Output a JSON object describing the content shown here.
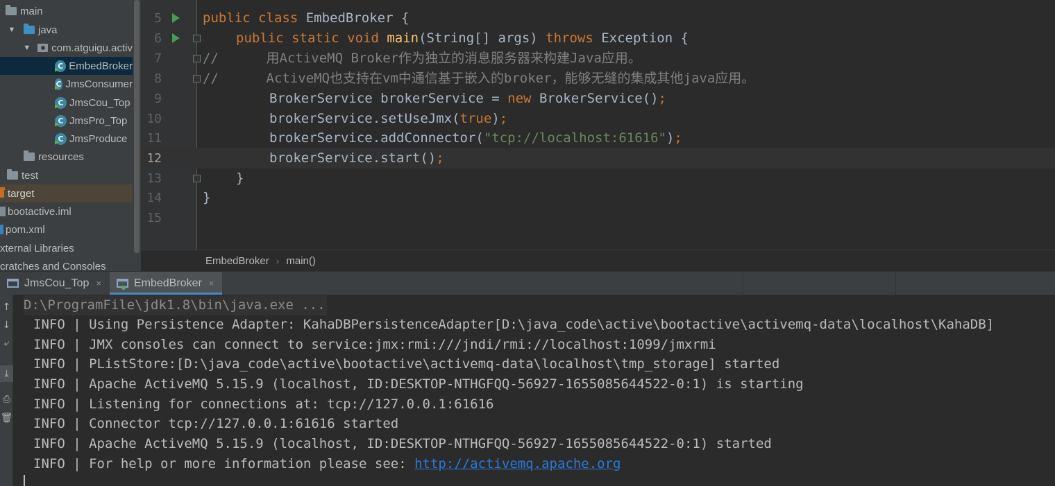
{
  "project_tree": {
    "items": [
      {
        "label": "main",
        "type": "folder"
      },
      {
        "label": "java",
        "type": "source-folder"
      },
      {
        "label": "com.atguigu.activ",
        "type": "package"
      },
      {
        "label": "EmbedBroker",
        "type": "class"
      },
      {
        "label": "JmsConsumer",
        "type": "class"
      },
      {
        "label": "JmsCou_Top",
        "type": "class"
      },
      {
        "label": "JmsPro_Top",
        "type": "class"
      },
      {
        "label": "JmsProduce",
        "type": "class"
      },
      {
        "label": "resources",
        "type": "folder"
      },
      {
        "label": "test",
        "type": "folder"
      },
      {
        "label": "target",
        "type": "excluded-folder"
      },
      {
        "label": "bootactive.iml",
        "type": "file"
      },
      {
        "label": "pom.xml",
        "type": "file"
      },
      {
        "label": "xternal Libraries",
        "type": "libraries"
      },
      {
        "label": "cratches and Consoles",
        "type": "scratches"
      }
    ],
    "selected": "EmbedBroker"
  },
  "editor": {
    "current_line": "12",
    "lines": [
      {
        "num": "5",
        "parts": [
          "public class ",
          "EmbedBroker {"
        ]
      },
      {
        "num": "6",
        "parts": [
          "public static void ",
          "main",
          "(String[] args) ",
          "throws ",
          "Exception {"
        ]
      },
      {
        "num": "7",
        "text": "//      用ActiveMQ Broker作为独立的消息服务器来构建Java应用。"
      },
      {
        "num": "8",
        "text": "//      ActiveMQ也支持在vm中通信基于嵌入的broker，能够无缝的集成其他java应用。"
      },
      {
        "num": "9",
        "parts": [
          "BrokerService brokerService = ",
          "new ",
          "BrokerService()",
          ";"
        ]
      },
      {
        "num": "10",
        "parts": [
          "brokerService.setUseJmx(",
          "true",
          ")",
          ";"
        ]
      },
      {
        "num": "11",
        "parts": [
          "brokerService.addConnector(",
          "\"tcp://localhost:61616\"",
          ")",
          ";"
        ]
      },
      {
        "num": "12",
        "parts": [
          "brokerService.start()",
          ";"
        ]
      },
      {
        "num": "13",
        "text": "}"
      },
      {
        "num": "14",
        "text": "}"
      },
      {
        "num": "15",
        "text": ""
      }
    ],
    "breadcrumb": [
      "EmbedBroker",
      "main()"
    ]
  },
  "run_tabs": [
    {
      "label": "JmsCou_Top",
      "close": "×"
    },
    {
      "label": "EmbedBroker",
      "close": "×"
    }
  ],
  "console": {
    "command": "D:\\ProgramFile\\jdk1.8\\bin\\java.exe ...",
    "lines": [
      "INFO | Using Persistence Adapter: KahaDBPersistenceAdapter[D:\\java_code\\active\\bootactive\\activemq-data\\localhost\\KahaDB]",
      "INFO | JMX consoles can connect to service:jmx:rmi:///jndi/rmi://localhost:1099/jmxrmi",
      "INFO | PListStore:[D:\\java_code\\active\\bootactive\\activemq-data\\localhost\\tmp_storage] started",
      "INFO | Apache ActiveMQ 5.15.9 (localhost, ID:DESKTOP-NTHGFQQ-56927-1655085644522-0:1) is starting",
      "INFO | Listening for connections at: tcp://127.0.0.1:61616",
      "INFO | Connector tcp://127.0.0.1:61616 started",
      "INFO | Apache ActiveMQ 5.15.9 (localhost, ID:DESKTOP-NTHGFQQ-56927-1655085644522-0:1) started"
    ],
    "help_prefix": "INFO | For help or more information please see: ",
    "help_link": "http://activemq.apache.org"
  },
  "colors": {
    "keyword": "#cc7832",
    "method": "#ffc66d",
    "string": "#6a8759",
    "comment": "#808080",
    "link": "#287bde",
    "selection": "#0d293e",
    "tab_accent": "#4a88c7"
  },
  "icons": [
    "folder-icon",
    "package-icon",
    "class-icon",
    "file-icon",
    "run-icon",
    "fold-icon",
    "close-icon",
    "console-icon"
  ]
}
